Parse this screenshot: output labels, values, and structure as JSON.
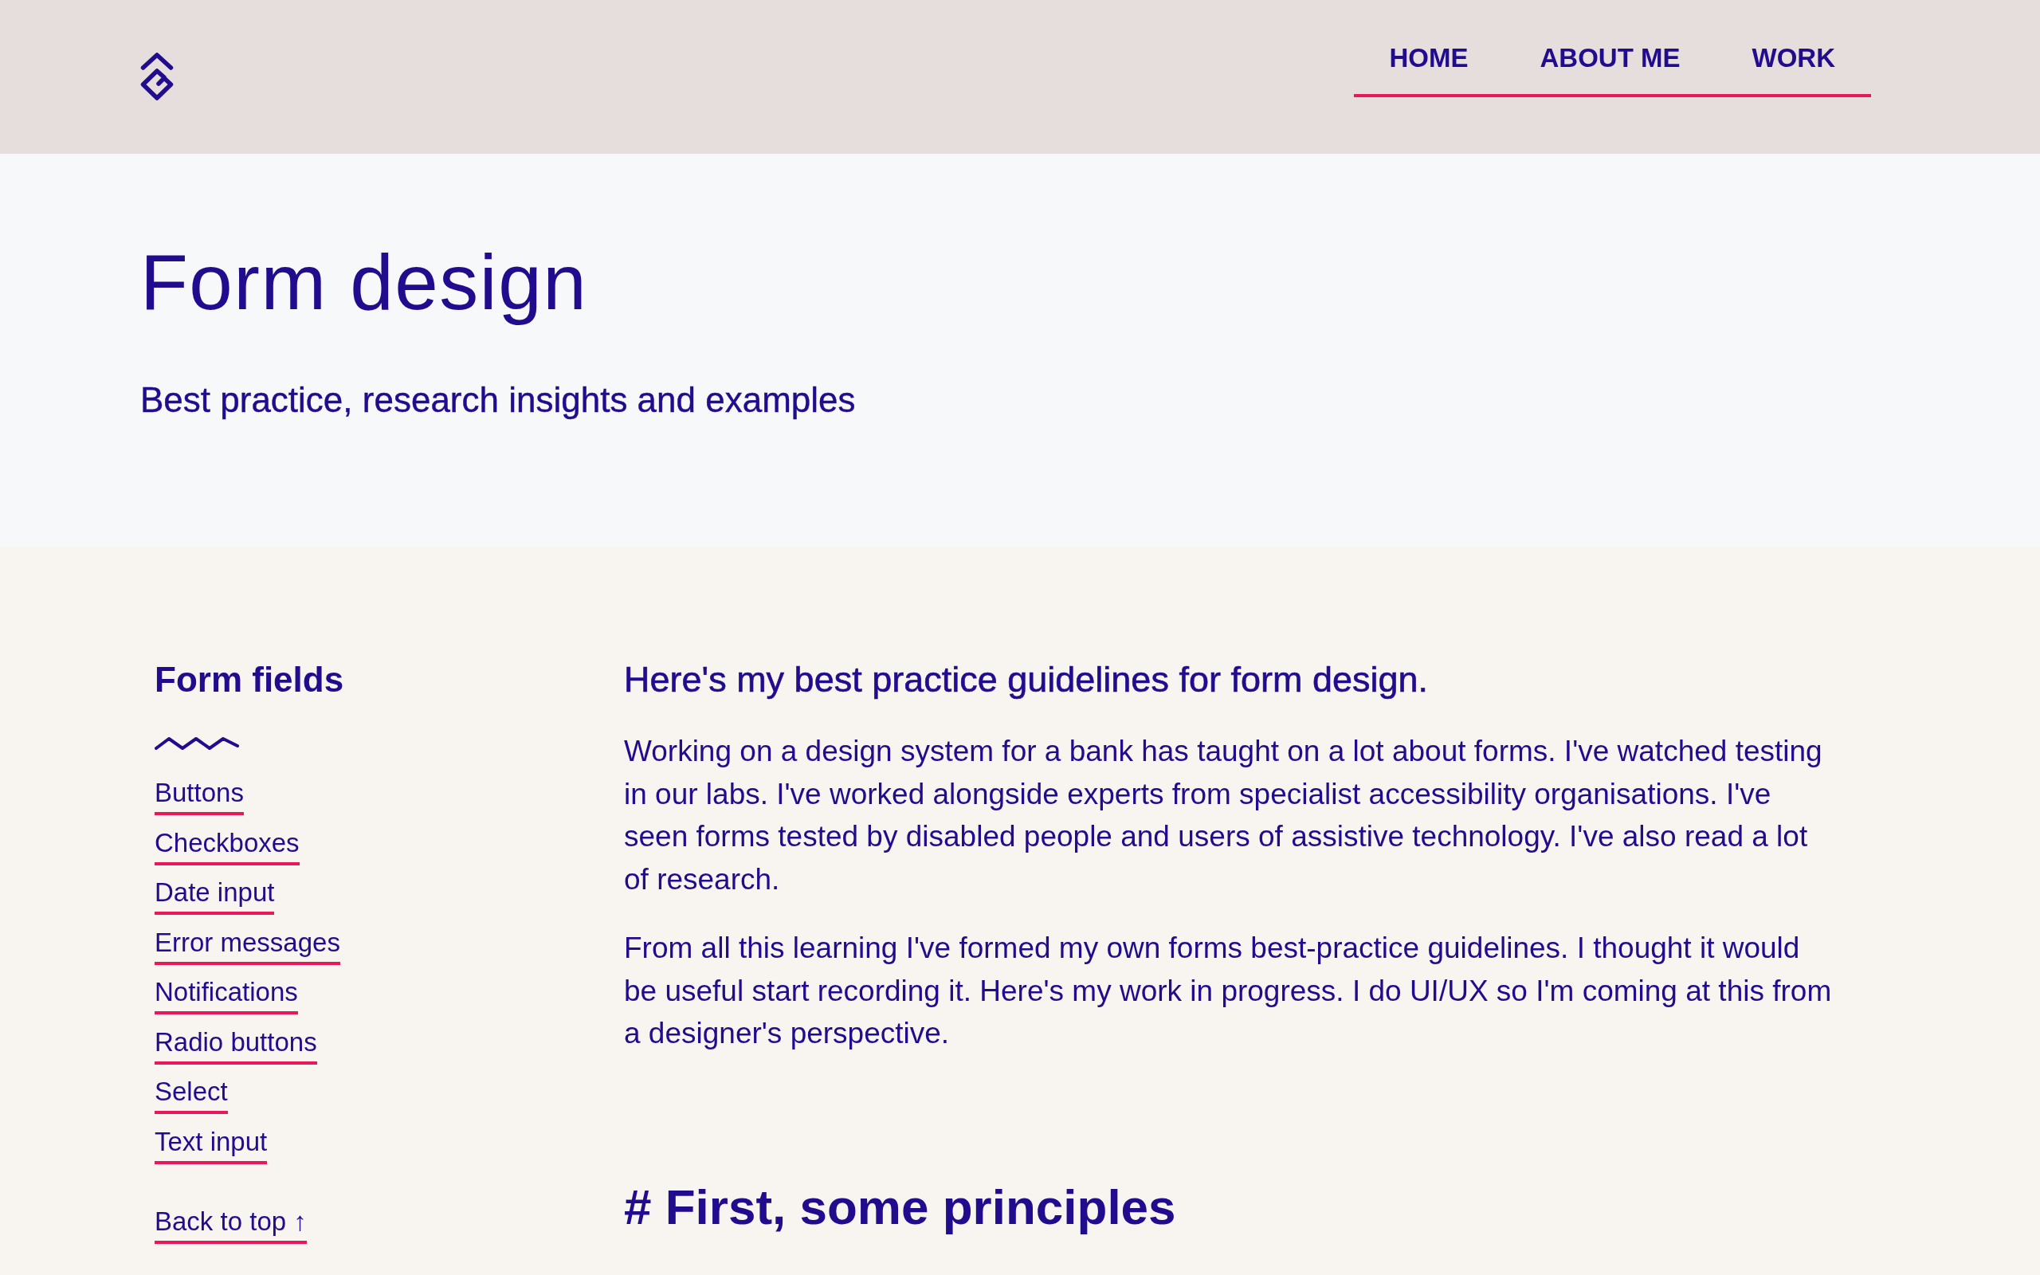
{
  "header": {
    "nav": [
      {
        "label": "HOME"
      },
      {
        "label": "ABOUT ME"
      },
      {
        "label": "WORK"
      }
    ]
  },
  "hero": {
    "title": "Form design",
    "subtitle": "Best practice, research insights and examples"
  },
  "sidebar": {
    "title": "Form fields",
    "links": [
      "Buttons",
      "Checkboxes",
      "Date input",
      "Error messages",
      "Notifications",
      "Radio buttons",
      "Select",
      "Text input"
    ],
    "back_to_top": "Back to top ↑"
  },
  "content": {
    "intro": "Here's my best practice guidelines for form design.",
    "paragraphs": [
      "Working on a design system for a bank has taught on a lot about forms. I've watched testing in our labs. I've worked alongside experts from specialist accessibility organisations. I've seen forms tested by disabled people and users of assistive technology. I've also read a lot of research.",
      "From all this learning I've formed my own forms best-practice guidelines. I thought it would be useful start recording it. Here's my work in progress. I do UI/UX so I'm coming at this from a designer's perspective."
    ],
    "section_heading": "# First, some principles"
  }
}
